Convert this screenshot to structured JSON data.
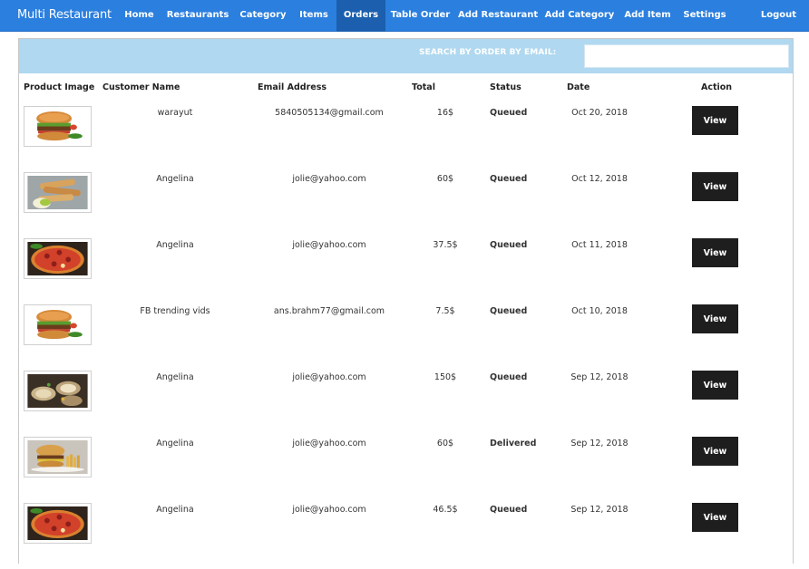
{
  "nav": {
    "brand": "Multi Restaurant",
    "links": [
      "Home",
      "Restaurants",
      "Category",
      "Items",
      "Orders",
      "Table Order",
      "Add Restaurant",
      "Add Category",
      "Add Item",
      "Settings",
      "Logout"
    ],
    "active": "Orders"
  },
  "search": {
    "label": "SEARCH BY ORDER BY EMAIL:",
    "value": "",
    "placeholder": ""
  },
  "table": {
    "headers": [
      "Product Image",
      "Customer Name",
      "Email Address",
      "Total",
      "Status",
      "Date",
      "Action"
    ],
    "rows": [
      {
        "image": "burger-icon",
        "name": "warayut",
        "email": "5840505134@gmail.com",
        "total": "16$",
        "status": "Queued",
        "date": "Oct 20, 2018",
        "action": "View"
      },
      {
        "image": "fries-icon",
        "name": "Angelina",
        "email": "jolie@yahoo.com",
        "total": "60$",
        "status": "Queued",
        "date": "Oct 12, 2018",
        "action": "View"
      },
      {
        "image": "pizza-icon",
        "name": "Angelina",
        "email": "jolie@yahoo.com",
        "total": "37.5$",
        "status": "Queued",
        "date": "Oct 11, 2018",
        "action": "View"
      },
      {
        "image": "burger-icon",
        "name": "FB trending vids",
        "email": "ans.brahm77@gmail.com",
        "total": "7.5$",
        "status": "Queued",
        "date": "Oct 10, 2018",
        "action": "View"
      },
      {
        "image": "seafood-icon",
        "name": "Angelina",
        "email": "jolie@yahoo.com",
        "total": "150$",
        "status": "Queued",
        "date": "Sep 12, 2018",
        "action": "View"
      },
      {
        "image": "burger-fries-icon",
        "name": "Angelina",
        "email": "jolie@yahoo.com",
        "total": "60$",
        "status": "Delivered",
        "date": "Sep 12, 2018",
        "action": "View"
      },
      {
        "image": "pizza-icon",
        "name": "Angelina",
        "email": "jolie@yahoo.com",
        "total": "46.5$",
        "status": "Queued",
        "date": "Sep 12, 2018",
        "action": "View"
      }
    ]
  },
  "colors": {
    "navbar": "#2b7fde",
    "nav_active": "#1b5fae",
    "search_bar": "#b0d8f0",
    "button": "#1e1e1e"
  }
}
